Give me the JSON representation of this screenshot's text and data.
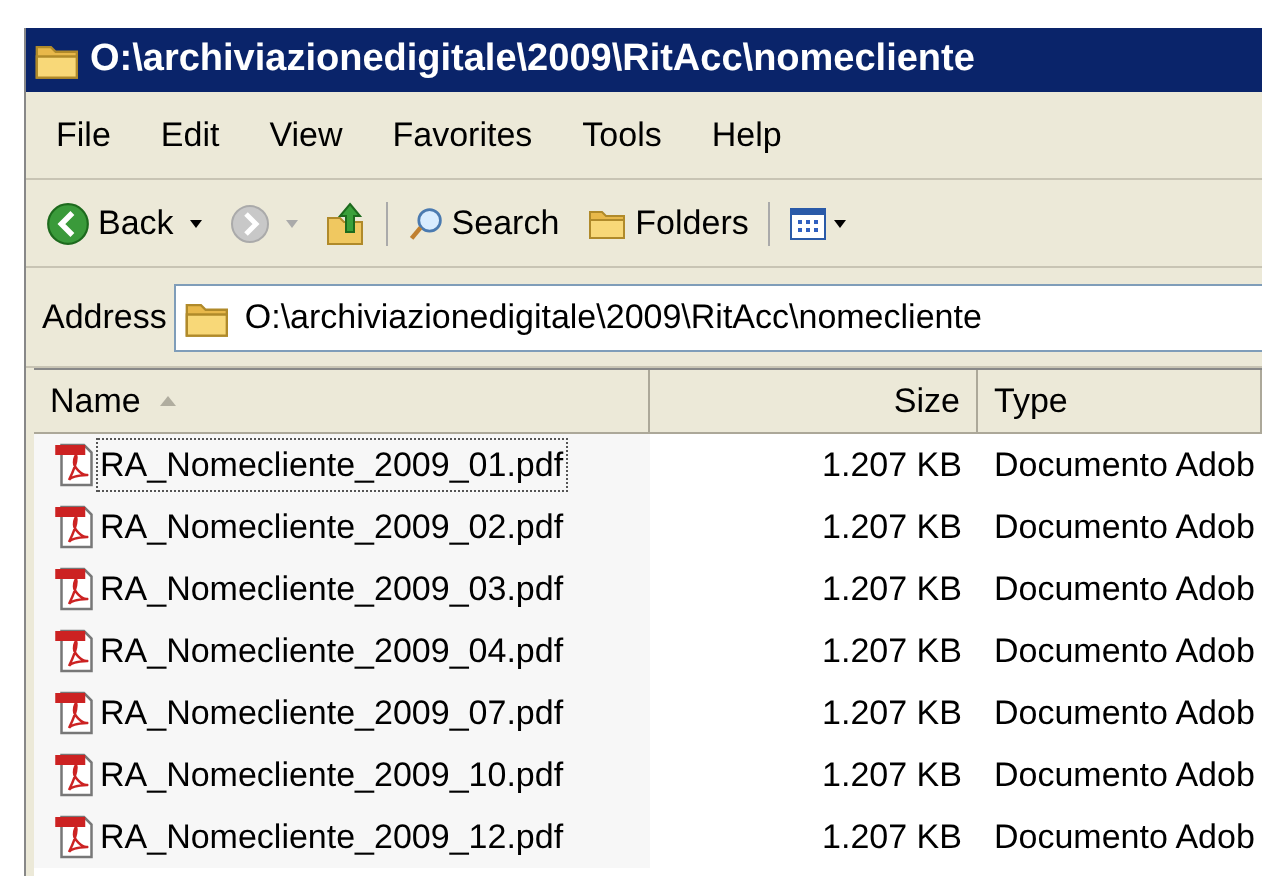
{
  "window": {
    "title": "O:\\archiviazionedigitale\\2009\\RitAcc\\nomecliente"
  },
  "menu": [
    "File",
    "Edit",
    "View",
    "Favorites",
    "Tools",
    "Help"
  ],
  "toolbar": [
    {
      "kind": "back",
      "label": "Back",
      "disabled": false
    },
    {
      "kind": "forward",
      "disabled": true
    },
    {
      "kind": "up"
    },
    {
      "kind": "search",
      "label": "Search"
    },
    {
      "kind": "folders",
      "label": "Folders"
    },
    {
      "kind": "views"
    }
  ],
  "address": {
    "label": "Address",
    "value": "O:\\archiviazionedigitale\\2009\\RitAcc\\nomecliente"
  },
  "table": {
    "columns": [
      "Name",
      "Size",
      "Type"
    ],
    "rows": [
      {
        "name": "RA_Nomecliente_2009_01.pdf",
        "size": "1.207 KB",
        "type": "Documento Adob",
        "focused": true
      },
      {
        "name": "RA_Nomecliente_2009_02.pdf",
        "size": "1.207 KB",
        "type": "Documento Adob",
        "focused": false
      },
      {
        "name": "RA_Nomecliente_2009_03.pdf",
        "size": "1.207 KB",
        "type": "Documento Adob",
        "focused": false
      },
      {
        "name": "RA_Nomecliente_2009_04.pdf",
        "size": "1.207 KB",
        "type": "Documento Adob",
        "focused": false
      },
      {
        "name": "RA_Nomecliente_2009_07.pdf",
        "size": "1.207 KB",
        "type": "Documento Adob",
        "focused": false
      },
      {
        "name": "RA_Nomecliente_2009_10.pdf",
        "size": "1.207 KB",
        "type": "Documento Adob",
        "focused": false
      },
      {
        "name": "RA_Nomecliente_2009_12.pdf",
        "size": "1.207 KB",
        "type": "Documento Adob",
        "focused": false
      }
    ]
  }
}
